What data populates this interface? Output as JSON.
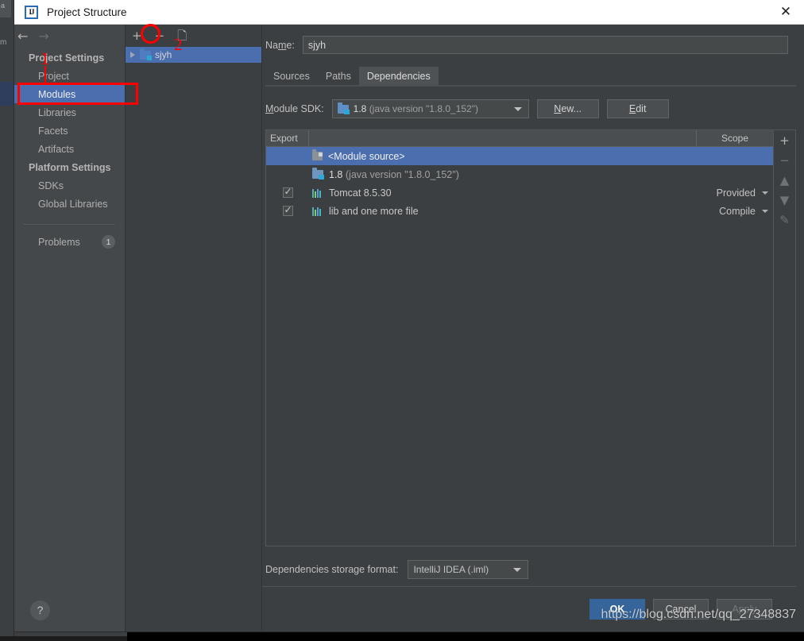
{
  "window": {
    "title": "Project Structure",
    "logo_icon": "intellij-idea-logo-icon",
    "close_icon": "close-icon"
  },
  "sidebar": {
    "back_icon": "arrow-left-icon",
    "forward_icon": "arrow-right-icon",
    "groups": [
      {
        "title": "Project Settings",
        "items": [
          {
            "label": "Project",
            "selected": false
          },
          {
            "label": "Modules",
            "selected": true
          },
          {
            "label": "Libraries",
            "selected": false
          },
          {
            "label": "Facets",
            "selected": false
          },
          {
            "label": "Artifacts",
            "selected": false
          }
        ]
      },
      {
        "title": "Platform Settings",
        "items": [
          {
            "label": "SDKs",
            "selected": false
          },
          {
            "label": "Global Libraries",
            "selected": false
          }
        ]
      }
    ],
    "problems": {
      "label": "Problems",
      "count": "1"
    },
    "help_label": "?"
  },
  "module_tree": {
    "toolbar": {
      "add_label": "+",
      "remove_label": "−",
      "copy_icon": "copy-icon"
    },
    "nodes": [
      {
        "label": "sjyh",
        "selected": true,
        "expand_icon": "triangle-right-icon"
      }
    ]
  },
  "module": {
    "name_label": "Name:",
    "name_label_pre": "Na",
    "name_label_mn": "m",
    "name_label_post": "e:",
    "name_value": "sjyh",
    "tabs": [
      {
        "label": "Sources",
        "active": false
      },
      {
        "label": "Paths",
        "active": false
      },
      {
        "label": "Dependencies",
        "active": true
      }
    ],
    "sdk": {
      "label_pre": "",
      "label_mn": "M",
      "label_post": "odule SDK:",
      "value_name": "1.8",
      "value_detail": "(java version \"1.8.0_152\")",
      "icon": "jdk-folder-icon",
      "new_button": {
        "pre": "",
        "mn": "N",
        "post": "ew..."
      },
      "edit_button": {
        "pre": "",
        "mn": "E",
        "post": "dit"
      }
    },
    "table": {
      "columns": {
        "export": "Export",
        "scope": "Scope"
      },
      "rows": [
        {
          "name": "<Module source>",
          "icon": "module-source-folder-icon",
          "export_checked": null,
          "scope": null,
          "selected": true
        },
        {
          "name": "1.8",
          "name_detail": "(java version \"1.8.0_152\")",
          "icon": "jdk-folder-icon",
          "export_checked": null,
          "scope": null,
          "selected": false
        },
        {
          "name": "Tomcat 8.5.30",
          "icon": "library-icon",
          "export_checked": true,
          "scope": "Provided",
          "selected": false
        },
        {
          "name": "lib and one more file",
          "icon": "library-icon",
          "export_checked": true,
          "scope": "Compile",
          "selected": false
        }
      ],
      "side_toolbar": [
        {
          "icon": "plus-icon",
          "label": "+",
          "enabled": true
        },
        {
          "icon": "minus-icon",
          "label": "−",
          "enabled": false
        },
        {
          "icon": "move-up-icon",
          "label": "▲",
          "enabled": false
        },
        {
          "icon": "move-down-icon",
          "label": "▼",
          "enabled": false
        },
        {
          "icon": "edit-pencil-icon",
          "label": "✎",
          "enabled": false
        }
      ]
    },
    "storage": {
      "label": "Dependencies storage format:",
      "value": "IntelliJ IDEA (.iml)"
    }
  },
  "footer": {
    "ok": "OK",
    "cancel": "Cancel",
    "apply": "Apply"
  },
  "annotations": {
    "marker_1": "1",
    "marker_2": "2",
    "watermark": "https://blog.csdn.net/qq_27348837",
    "color": "#ff0000"
  },
  "background": {
    "left_tab_label": "a",
    "left_text": "m"
  }
}
